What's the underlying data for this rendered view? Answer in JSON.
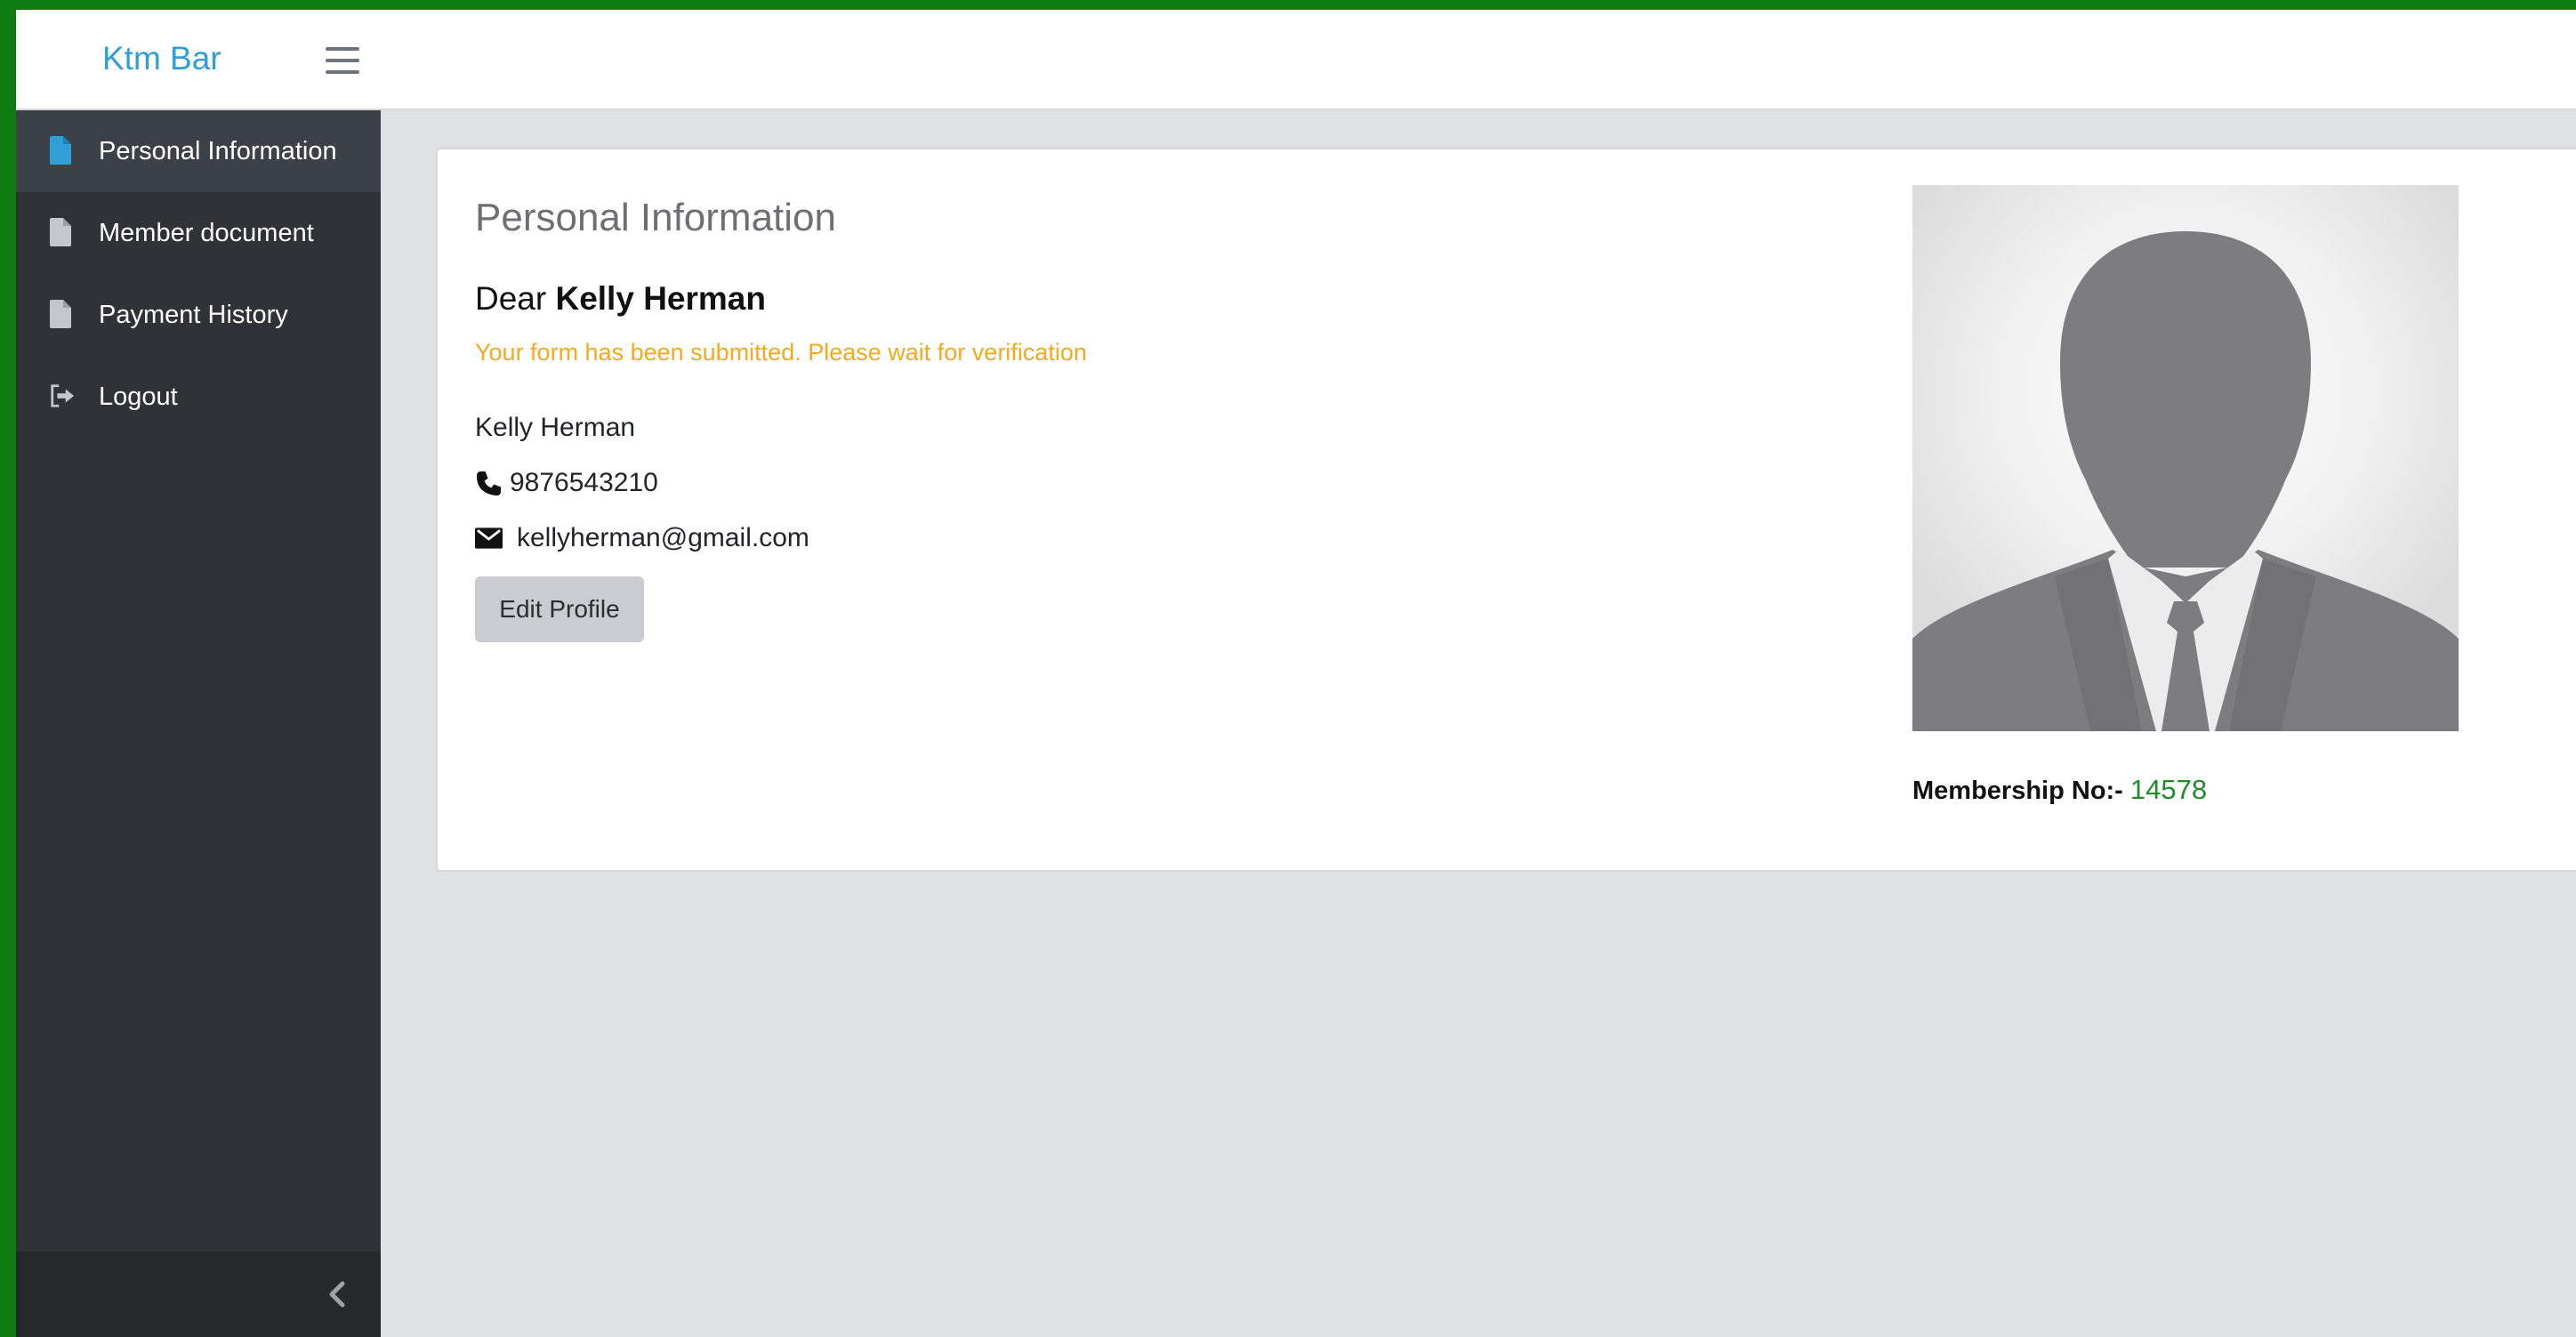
{
  "app": {
    "brand": "Ktm Bar"
  },
  "sidebar": {
    "items": [
      {
        "label": "Personal Information",
        "icon": "document-icon",
        "active": true
      },
      {
        "label": "Member document",
        "icon": "document-icon",
        "active": false
      },
      {
        "label": "Payment History",
        "icon": "document-icon",
        "active": false
      },
      {
        "label": "Logout",
        "icon": "sign-out-icon",
        "active": false
      }
    ],
    "collapse_icon": "chevron-left-icon"
  },
  "profile": {
    "title": "Personal Information",
    "greeting_prefix": "Dear",
    "greeting_name": "Kelly Herman",
    "notice": "Your form has been submitted. Please wait for verification",
    "name": "Kelly Herman",
    "phone": "9876543210",
    "email": "kellyherman@gmail.com",
    "edit_button": "Edit Profile",
    "membership_label": "Membership No:-",
    "membership_number": "14578"
  },
  "colors": {
    "accent": "#2f9fd6",
    "sidebar_bg": "#2f3236",
    "notice": "#f4a91e",
    "membership_value": "#1f8c2a",
    "frame_border": "#0e7a12"
  }
}
